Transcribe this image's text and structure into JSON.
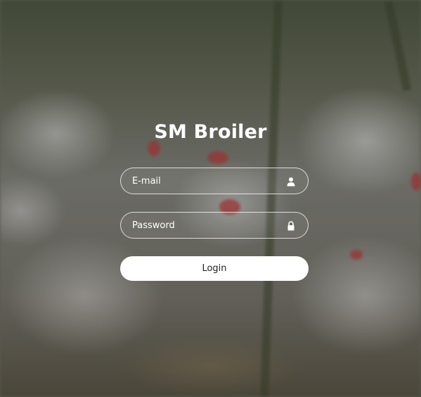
{
  "app": {
    "title": "SM Broiler"
  },
  "form": {
    "email_placeholder": "E-mail",
    "email_value": "",
    "password_placeholder": "Password",
    "password_value": "",
    "login_label": "Login"
  },
  "icons": {
    "email": "user-icon",
    "password": "lock-icon"
  },
  "colors": {
    "text": "#ffffff",
    "button_bg": "#ffffff",
    "button_text": "#222222",
    "field_border": "#ffffff"
  }
}
